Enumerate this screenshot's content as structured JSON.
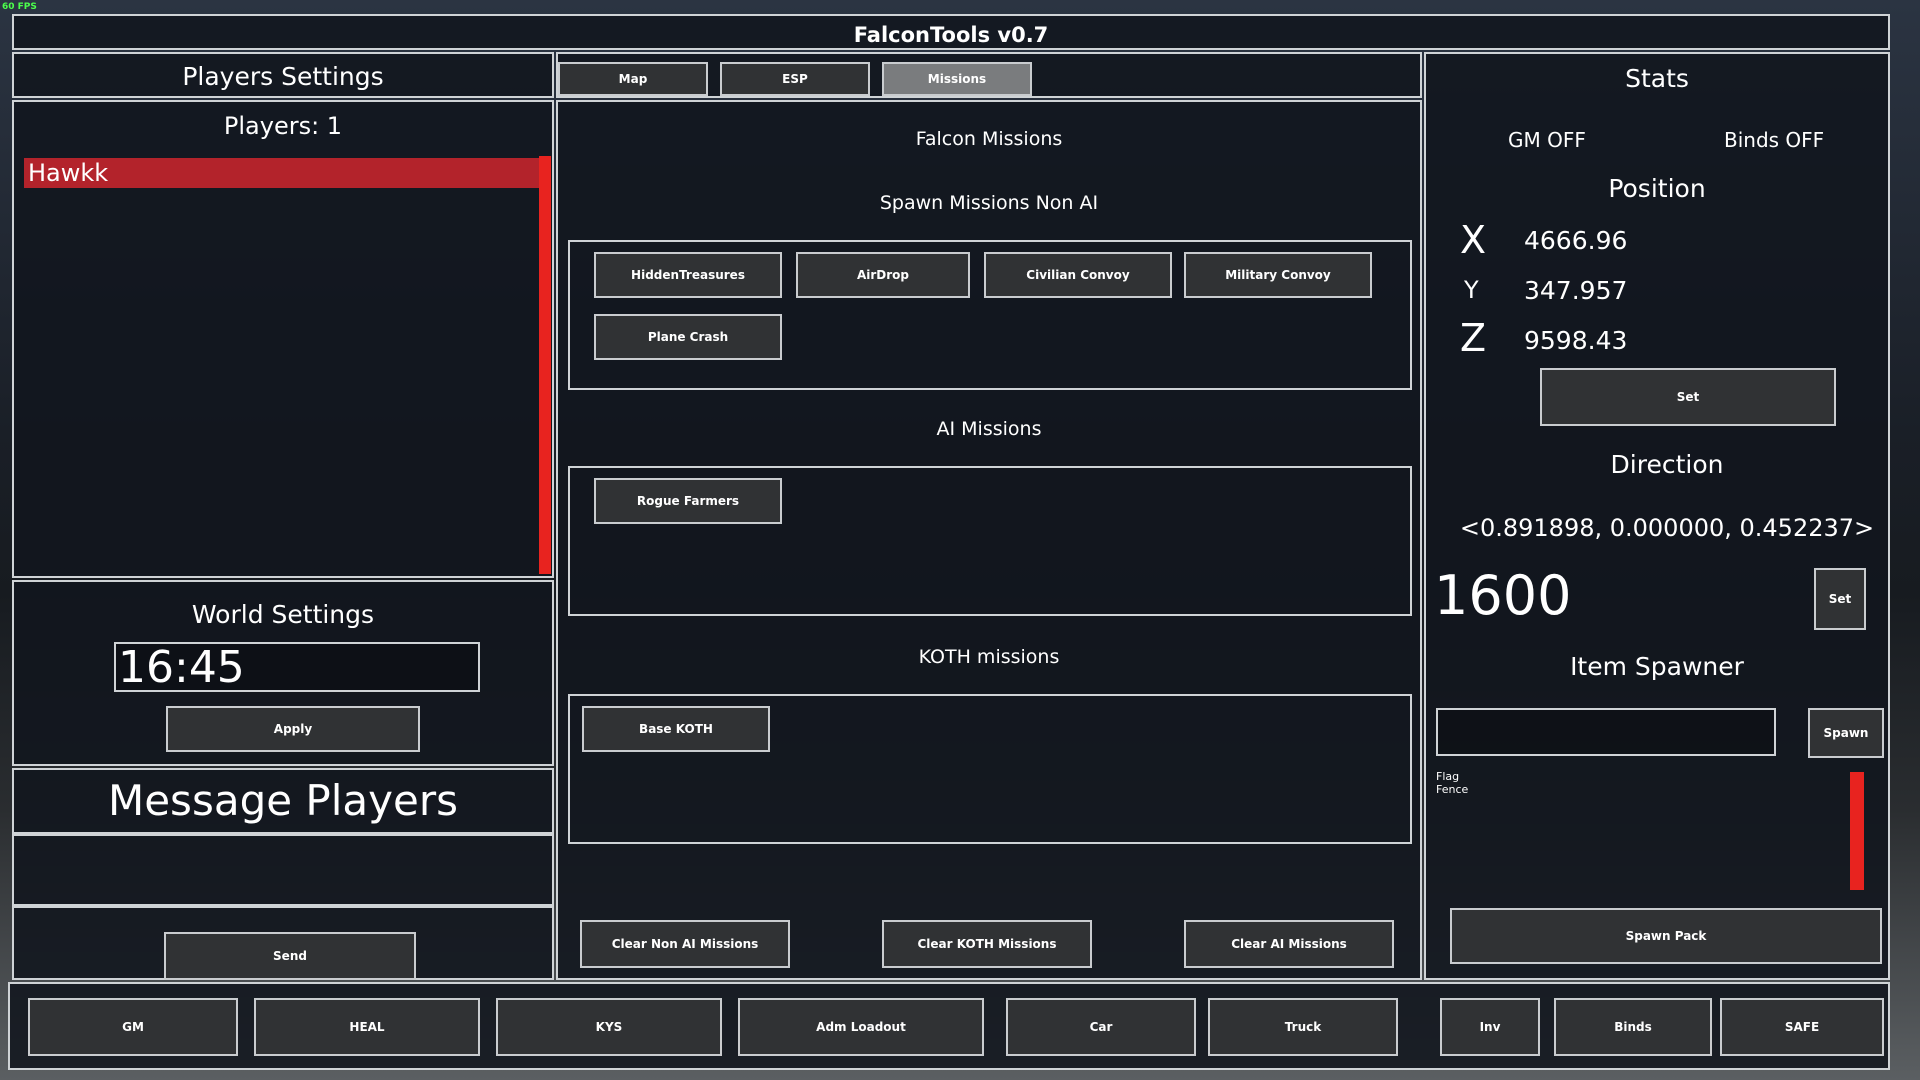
{
  "fps": "60 FPS",
  "title": "FalconTools v0.7",
  "players_panel": {
    "header": "Players Settings",
    "count_label": "Players: 1",
    "players": [
      "Hawkk"
    ]
  },
  "world_settings": {
    "header": "World Settings",
    "time_value": "16:45",
    "apply_label": "Apply"
  },
  "message_players": {
    "header": "Message Players",
    "message_value": "",
    "send_label": "Send"
  },
  "tabs": [
    {
      "label": "Map"
    },
    {
      "label": "ESP"
    },
    {
      "label": "Missions"
    }
  ],
  "missions": {
    "title": "Falcon Missions",
    "non_ai_header": "Spawn Missions Non AI",
    "non_ai_buttons": [
      "HiddenTreasures",
      "AirDrop",
      "Civilian Convoy",
      "Military Convoy",
      "Plane Crash"
    ],
    "ai_header": "AI Missions",
    "ai_buttons": [
      "Rogue Farmers"
    ],
    "koth_header": "KOTH missions",
    "koth_buttons": [
      "Base KOTH"
    ],
    "clear_non_ai": "Clear Non AI Missions",
    "clear_koth": "Clear KOTH Missions",
    "clear_ai": "Clear AI Missions"
  },
  "stats": {
    "header": "Stats",
    "gm_status": "GM OFF",
    "binds_status": "Binds OFF",
    "position_header": "Position",
    "x_label": "X",
    "x_value": "4666.96",
    "y_label": "Y",
    "y_value": "347.957",
    "z_label": "Z",
    "z_value": "9598.43",
    "set_position_label": "Set",
    "direction_header": "Direction",
    "direction_value": "<0.891898, 0.000000, 0.452237>",
    "distance_value": "1600",
    "set_direction_label": "Set",
    "item_spawner_header": "Item Spawner",
    "item_input_value": "",
    "spawn_label": "Spawn",
    "item_list": [
      "Flag",
      "Fence"
    ],
    "spawn_pack_label": "Spawn Pack"
  },
  "bottom_bar": [
    "GM",
    "HEAL",
    "KYS",
    "Adm Loadout",
    "Car",
    "Truck",
    "Inv",
    "Binds",
    "SAFE"
  ],
  "colors": {
    "accent_red": "#e8231f",
    "player_highlight": "#b3232b",
    "panel_bg": "#11161e",
    "button_bg": "#303234",
    "active_tab_bg": "#7a7c7e"
  }
}
